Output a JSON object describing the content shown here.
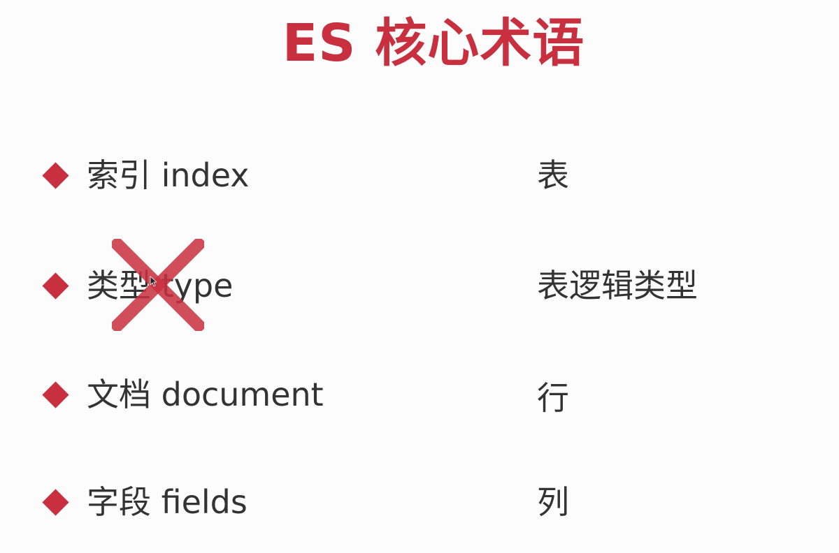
{
  "slide": {
    "title": "ES 核心术语",
    "accent_color": "#c8303f",
    "text_color": "#333333",
    "items": [
      {
        "term": "索引 index",
        "meaning": "表",
        "struck": false
      },
      {
        "term": "类型 type",
        "meaning": "表逻辑类型",
        "struck": true
      },
      {
        "term": "文档 document",
        "meaning": "行",
        "struck": false
      },
      {
        "term": "字段 fields",
        "meaning": "列",
        "struck": false
      }
    ],
    "icons": {
      "bullet": "diamond-bullet-icon",
      "strike": "cross-mark-icon",
      "cursor": "mouse-pointer-icon"
    }
  }
}
